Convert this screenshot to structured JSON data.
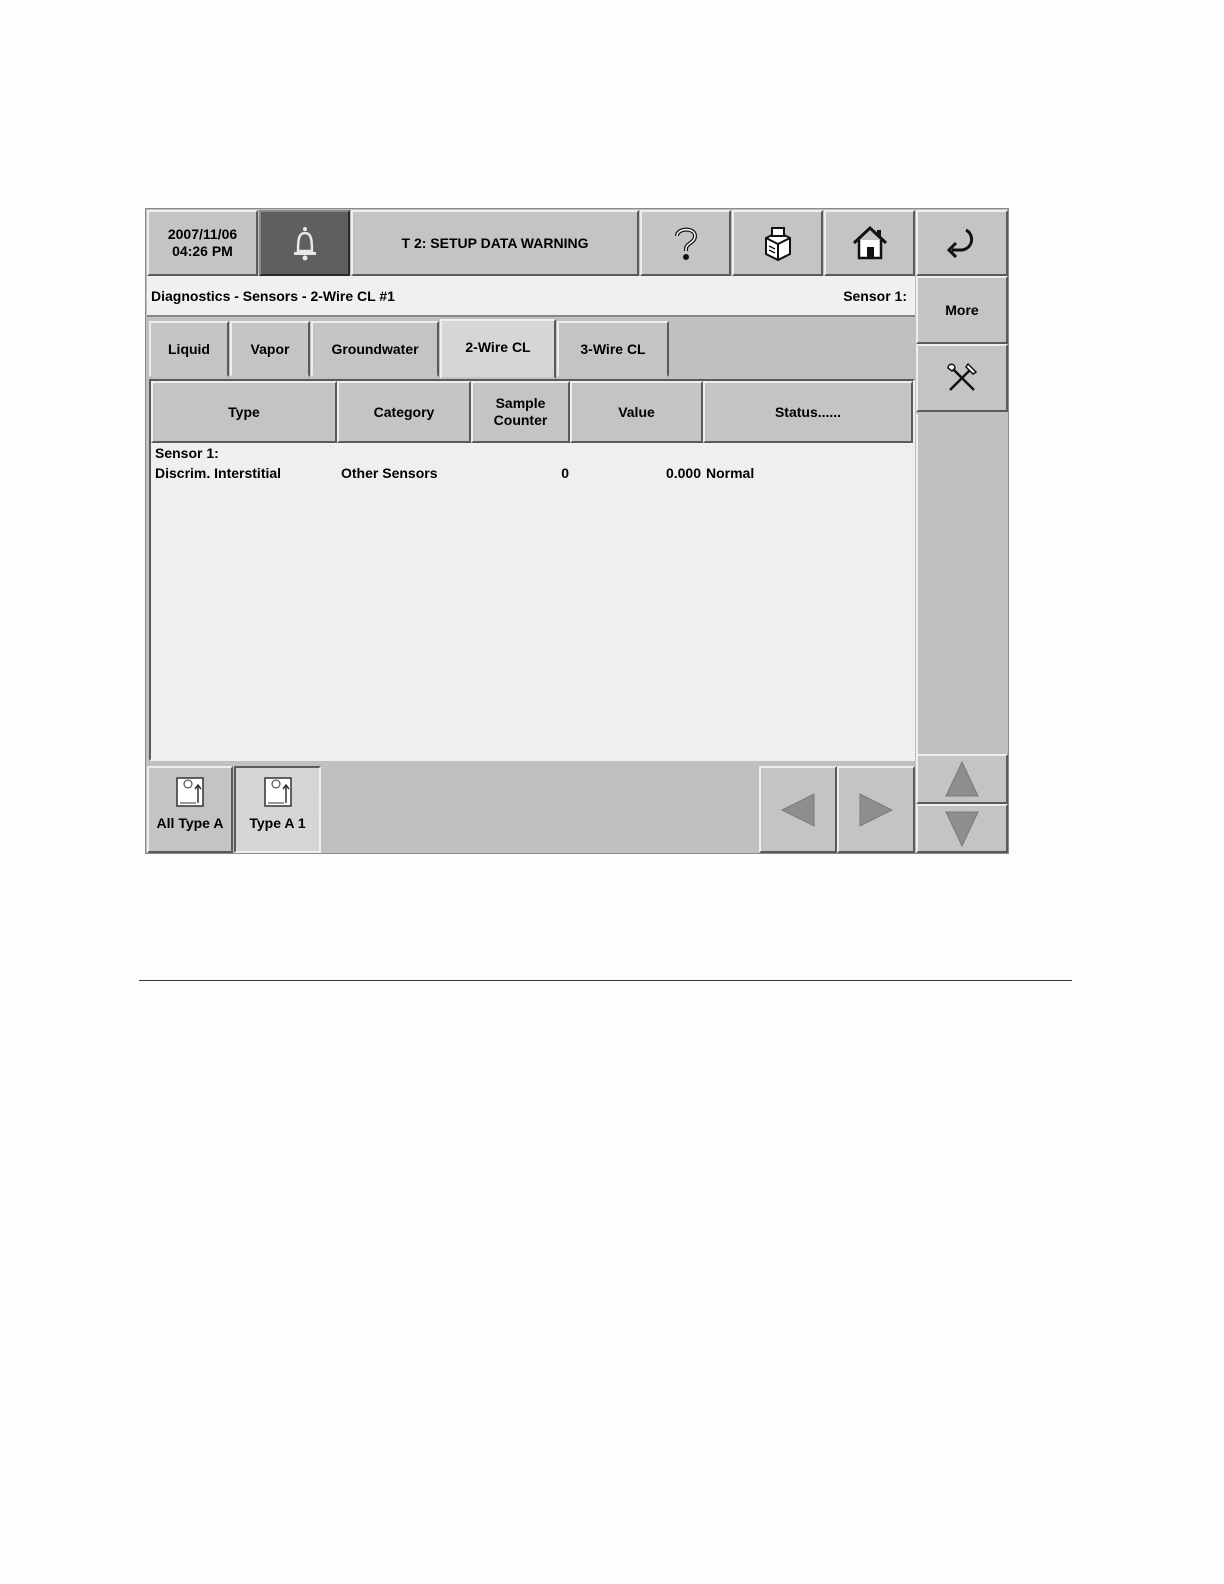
{
  "header": {
    "date": "2007/11/06",
    "time": "04:26 PM",
    "alarm_icon": "bell-icon",
    "status_message": "T 2: SETUP DATA WARNING",
    "help_icon": "question-icon",
    "printer_icon": "printer-icon",
    "home_icon": "home-icon",
    "back_icon": "back-arrow-icon"
  },
  "breadcrumb": {
    "path": "Diagnostics - Sensors - 2-Wire CL #1",
    "context": "Sensor 1:"
  },
  "side_buttons": {
    "more_label": "More",
    "tools_icon": "tools-icon",
    "scroll_up_icon": "up-arrow-icon",
    "scroll_down_icon": "down-arrow-icon"
  },
  "tabs": [
    {
      "label": "Liquid",
      "active": false
    },
    {
      "label": "Vapor",
      "active": false
    },
    {
      "label": "Groundwater",
      "active": false
    },
    {
      "label": "2-Wire CL",
      "active": true
    },
    {
      "label": "3-Wire CL",
      "active": false
    }
  ],
  "table": {
    "columns": [
      "Type",
      "Category",
      "Sample\nCounter",
      "Value",
      "Status......"
    ],
    "group_label": "Sensor 1:",
    "rows": [
      {
        "type": "Discrim. Interstitial",
        "category": "Other Sensors",
        "sample_counter": "0",
        "value": "0.000",
        "status": "Normal"
      }
    ]
  },
  "footer": {
    "buttons": [
      {
        "label": "All Type A",
        "icon": "sensor-icon",
        "active": false
      },
      {
        "label": "Type A 1",
        "icon": "sensor-icon",
        "active": true
      }
    ],
    "prev_icon": "left-arrow-icon",
    "next_icon": "right-arrow-icon"
  }
}
